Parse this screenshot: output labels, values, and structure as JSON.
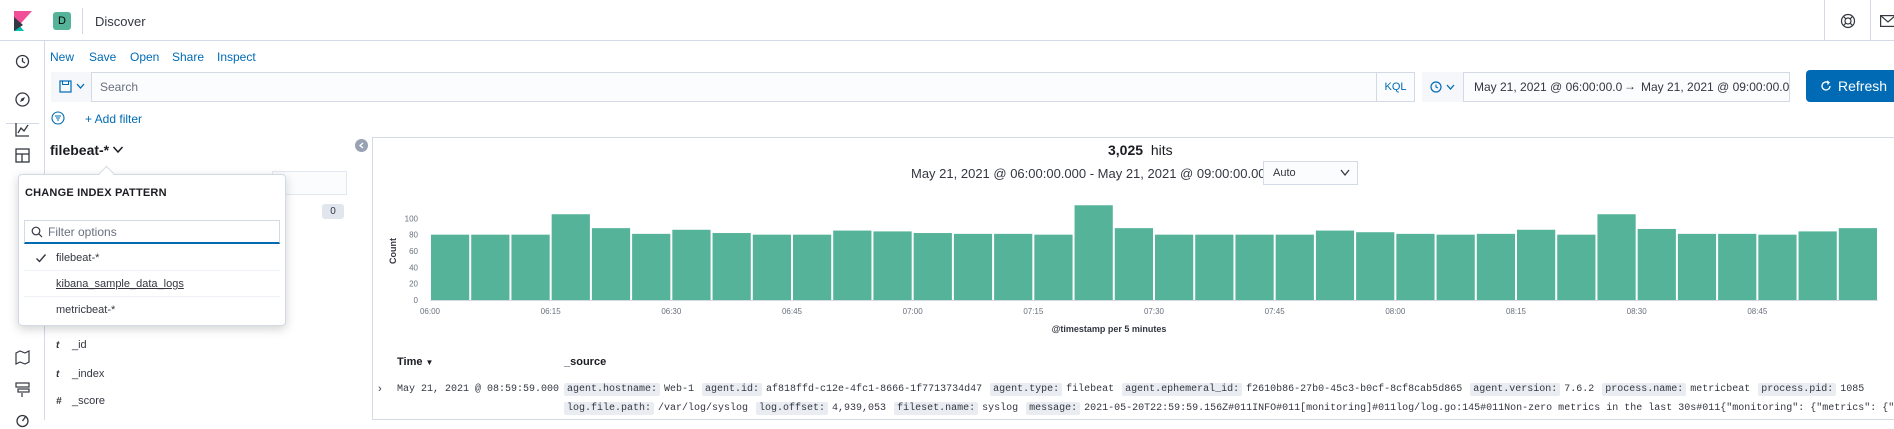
{
  "header": {
    "app_title": "Discover",
    "space_initial": "D"
  },
  "menu": {
    "new": "New",
    "save": "Save",
    "open": "Open",
    "share": "Share",
    "inspect": "Inspect"
  },
  "query": {
    "placeholder": "Search",
    "language": "KQL"
  },
  "time": {
    "start": "May 21, 2021 @ 06:00:00.0",
    "arrow": "→",
    "end": "May 21, 2021 @ 09:00:00.0",
    "refresh_label": "Refresh"
  },
  "filters": {
    "add_label": "+ Add filter"
  },
  "sidebar": {
    "index_pattern": "filebeat-*",
    "hidden_count": "0",
    "fields": [
      {
        "type": "t",
        "name": "_id"
      },
      {
        "type": "t",
        "name": "_index"
      },
      {
        "type": "#",
        "name": "_score"
      }
    ]
  },
  "popover": {
    "title": "CHANGE INDEX PATTERN",
    "placeholder": "Filter options",
    "options": [
      {
        "label": "filebeat-*",
        "selected": true
      },
      {
        "label": "kibana_sample_data_logs",
        "selected": false
      },
      {
        "label": "metricbeat-*",
        "selected": false
      }
    ]
  },
  "results": {
    "hits": "3,025",
    "hits_label": "hits",
    "range": "May 21, 2021 @ 06:00:00.000 - May 21, 2021 @ 09:00:00.000 —",
    "interval": "Auto"
  },
  "chart_data": {
    "type": "bar",
    "title": "",
    "xlabel": "@timestamp per 5 minutes",
    "ylabel": "Count",
    "ylim": [
      0,
      120
    ],
    "yticks": [
      0,
      20,
      40,
      60,
      80,
      100
    ],
    "xtick_labels": [
      "06:00",
      "06:15",
      "06:30",
      "06:45",
      "07:00",
      "07:15",
      "07:30",
      "07:45",
      "08:00",
      "08:15",
      "08:30",
      "08:45"
    ],
    "categories": [
      "06:00",
      "06:05",
      "06:10",
      "06:15",
      "06:20",
      "06:25",
      "06:30",
      "06:35",
      "06:40",
      "06:45",
      "06:50",
      "06:55",
      "07:00",
      "07:05",
      "07:10",
      "07:15",
      "07:20",
      "07:25",
      "07:30",
      "07:35",
      "07:40",
      "07:45",
      "07:50",
      "07:55",
      "08:00",
      "08:05",
      "08:10",
      "08:15",
      "08:20",
      "08:25",
      "08:30",
      "08:35",
      "08:40",
      "08:45",
      "08:50",
      "08:55"
    ],
    "values": [
      80,
      80,
      80,
      105,
      88,
      81,
      86,
      82,
      80,
      80,
      85,
      84,
      82,
      81,
      81,
      80,
      116,
      88,
      80,
      80,
      80,
      80,
      85,
      83,
      81,
      80,
      81,
      86,
      80,
      105,
      87,
      81,
      81,
      80,
      84,
      88
    ],
    "bar_color": "#54b399"
  },
  "table": {
    "col_time": "Time",
    "col_source": "_source",
    "row_time": "May 21, 2021 @ 08:59:59.000",
    "line1": [
      {
        "k": "agent.hostname:",
        "v": "Web-1"
      },
      {
        "k": "agent.id:",
        "v": "af818ffd-c12e-4fc1-8666-1f7713734d47"
      },
      {
        "k": "agent.type:",
        "v": "filebeat"
      },
      {
        "k": "agent.ephemeral_id:",
        "v": "f2610b86-27b0-45c3-b0cf-8cf8cab5d865"
      },
      {
        "k": "agent.version:",
        "v": "7.6.2"
      },
      {
        "k": "process.name:",
        "v": "metricbeat"
      },
      {
        "k": "process.pid:",
        "v": "1085"
      }
    ],
    "line2": [
      {
        "k": "log.file.path:",
        "v": "/var/log/syslog"
      },
      {
        "k": "log.offset:",
        "v": "4,939,053"
      },
      {
        "k": "fileset.name:",
        "v": "syslog"
      },
      {
        "k": "message:",
        "v": "2021-05-20T22:59:59.156Z#011INFO#011[monitoring]#011log/log.go:145#011Non-zero metrics in the last 30s#011{\"monitoring\": {\"metrics\": {\"beat\":"
      }
    ]
  },
  "colors": {
    "accent": "#006bb4",
    "bar": "#54b399",
    "border": "#d3dae6"
  }
}
